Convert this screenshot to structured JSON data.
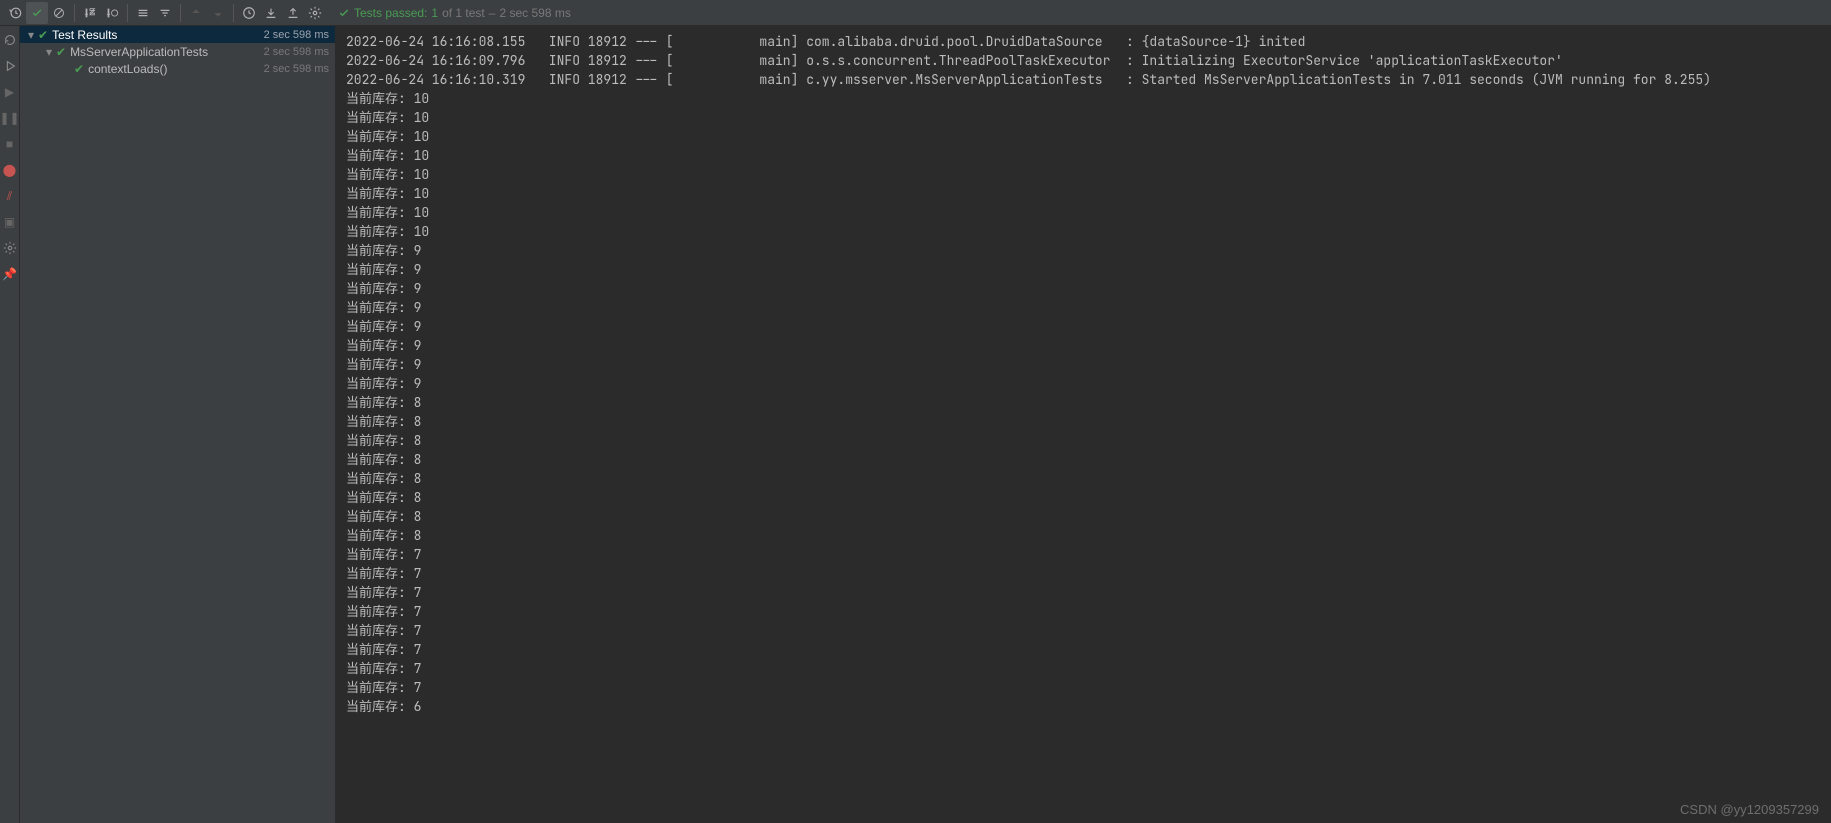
{
  "status": {
    "prefix": "Tests passed:",
    "count": "1",
    "mid": "of 1 test",
    "dash": "–",
    "duration": "2 sec 598 ms"
  },
  "tree": {
    "n0": {
      "label": "Test Results",
      "time": "2 sec 598 ms"
    },
    "n1": {
      "label": "MsServerApplicationTests",
      "time": "2 sec 598 ms"
    },
    "n2": {
      "label": "contextLoads()",
      "time": "2 sec 598 ms"
    }
  },
  "console_lines": [
    "2022-06-24 16:16:08.155   INFO 18912 --- [           main] com.alibaba.druid.pool.DruidDataSource   : {dataSource-1} inited",
    "2022-06-24 16:16:09.796   INFO 18912 --- [           main] o.s.s.concurrent.ThreadPoolTaskExecutor  : Initializing ExecutorService 'applicationTaskExecutor'",
    "2022-06-24 16:16:10.319   INFO 18912 --- [           main] c.yy.msserver.MsServerApplicationTests   : Started MsServerApplicationTests in 7.011 seconds (JVM running for 8.255)",
    "当前库存: 10",
    "当前库存: 10",
    "当前库存: 10",
    "当前库存: 10",
    "当前库存: 10",
    "当前库存: 10",
    "当前库存: 10",
    "当前库存: 10",
    "当前库存: 9",
    "当前库存: 9",
    "当前库存: 9",
    "当前库存: 9",
    "当前库存: 9",
    "当前库存: 9",
    "当前库存: 9",
    "当前库存: 9",
    "当前库存: 8",
    "当前库存: 8",
    "当前库存: 8",
    "当前库存: 8",
    "当前库存: 8",
    "当前库存: 8",
    "当前库存: 8",
    "当前库存: 8",
    "当前库存: 7",
    "当前库存: 7",
    "当前库存: 7",
    "当前库存: 7",
    "当前库存: 7",
    "当前库存: 7",
    "当前库存: 7",
    "当前库存: 7",
    "当前库存: 6"
  ],
  "watermark": "CSDN @yy1209357299"
}
